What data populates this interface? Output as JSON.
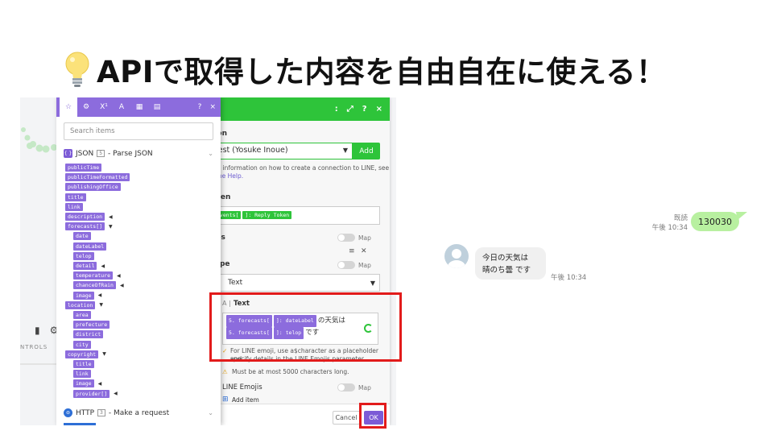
{
  "headline": {
    "text": "APIで取得した内容を自由自在に使える！"
  },
  "colors": {
    "make_green": "#2ec43a",
    "mapper_purple": "#8c6cdd",
    "highlight_red": "#e21b1b",
    "line_bubble": "#b8f0a0"
  },
  "canvas": {
    "controls_label": "NTROLS"
  },
  "panel": {
    "header_icons": [
      "more-icon",
      "expand-icon",
      "help-icon",
      "close-icon"
    ],
    "header_glyphs": [
      ":",
      "⤢",
      "?",
      "×"
    ],
    "connection_label": "tion",
    "connection_value": "test (Yosuke Inoue)",
    "add_label": "Add",
    "connection_help_1": "ore information on how to create a connection to LINE, see",
    "connection_help_2": "nline Help.",
    "token_label": "oken",
    "token_pills": [
      "events[",
      "]: Reply Token"
    ],
    "messages_label": "ges",
    "map_label": "Map",
    "item_label": "1",
    "type_label": "Type",
    "type_value": "Text",
    "text_label": "Text",
    "text_line1_pills": [
      "5. forecasts[",
      "]: dateLabel"
    ],
    "text_line1_suffix": "の天気は",
    "text_line2_pills": [
      "5. forecasts[",
      "]: telop"
    ],
    "text_line2_suffix": "です",
    "emoji_help_1": "For LINE emoji, use a$character as a placeholder and",
    "emoji_help_2": "specify details in the LINE Emojis parameter.",
    "limit_warning": "Must be at most 5000 characters long.",
    "emojis_label": "LINE Emojis",
    "add_item_label": "Add item",
    "cancel_label": "Cancel",
    "ok_label": "OK"
  },
  "mapper": {
    "tabs": [
      "star-icon",
      "gear-icon",
      "superscript-icon",
      "text-icon",
      "calendar-icon",
      "table-icon"
    ],
    "tab_glyphs": [
      "☆",
      "⚙",
      "X¹",
      "A",
      "▦",
      "▤"
    ],
    "search_placeholder": "Search items",
    "module1": {
      "name": "JSON",
      "number": "5",
      "action": "- Parse JSON"
    },
    "module2": {
      "name": "HTTP",
      "number": "3",
      "action": "- Make a request"
    },
    "items": [
      {
        "label": "publicTime",
        "indent": 0,
        "arrow": ""
      },
      {
        "label": "publicTimeFormatted",
        "indent": 0,
        "arrow": ""
      },
      {
        "label": "publishingOffice",
        "indent": 0,
        "arrow": ""
      },
      {
        "label": "title",
        "indent": 0,
        "arrow": ""
      },
      {
        "label": "link",
        "indent": 0,
        "arrow": ""
      },
      {
        "label": "description",
        "indent": 0,
        "arrow": "◀"
      },
      {
        "label": "forecasts[]",
        "indent": 0,
        "arrow": "▼"
      },
      {
        "label": "date",
        "indent": 1,
        "arrow": ""
      },
      {
        "label": "dateLabel",
        "indent": 1,
        "arrow": ""
      },
      {
        "label": "telop",
        "indent": 1,
        "arrow": ""
      },
      {
        "label": "detail",
        "indent": 1,
        "arrow": "◀"
      },
      {
        "label": "temperature",
        "indent": 1,
        "arrow": "◀"
      },
      {
        "label": "chanceOfRain",
        "indent": 1,
        "arrow": "◀"
      },
      {
        "label": "image",
        "indent": 1,
        "arrow": "◀"
      },
      {
        "label": "location",
        "indent": 0,
        "arrow": "▼"
      },
      {
        "label": "area",
        "indent": 1,
        "arrow": ""
      },
      {
        "label": "prefecture",
        "indent": 1,
        "arrow": ""
      },
      {
        "label": "district",
        "indent": 1,
        "arrow": ""
      },
      {
        "label": "city",
        "indent": 1,
        "arrow": ""
      },
      {
        "label": "copyright",
        "indent": 0,
        "arrow": "▼"
      },
      {
        "label": "title",
        "indent": 1,
        "arrow": ""
      },
      {
        "label": "link",
        "indent": 1,
        "arrow": ""
      },
      {
        "label": "image",
        "indent": 1,
        "arrow": "◀"
      },
      {
        "label": "provider[]",
        "indent": 1,
        "arrow": "◀"
      }
    ]
  },
  "chat": {
    "read_label": "既読",
    "sent_time": "午後 10:34",
    "sent_text": "130030",
    "reply_line1": "今日の天気は",
    "reply_line2": "晴のち曇 です",
    "reply_time": "午後 10:34"
  }
}
